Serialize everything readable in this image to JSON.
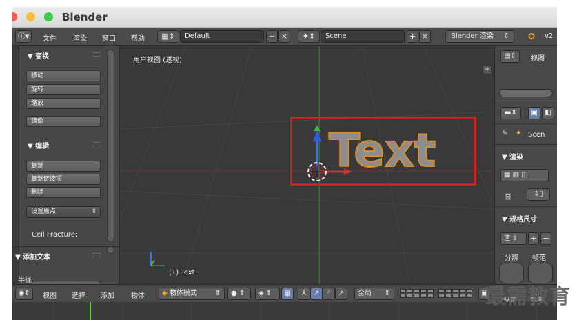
{
  "window": {
    "title": "Blender",
    "traffic_lights": [
      "#ee5a54",
      "#f6be3c",
      "#3cc94a"
    ]
  },
  "menubar": {
    "info_icon": "info-icon",
    "menus": [
      "文件",
      "渲染",
      "窗口",
      "帮助"
    ],
    "layout_name": "Default",
    "scene_name": "Scene",
    "render_engine": "Blender 渲染",
    "version_partial": "v2"
  },
  "toolshelf": {
    "transform_header": "▼ 变换",
    "transform_buttons": [
      "移动",
      "旋转",
      "缩放"
    ],
    "mirror_button": "镜像",
    "edit_header": "▼ 编辑",
    "edit_buttons": [
      "复制",
      "复制链接项",
      "删除"
    ],
    "set_origin": "设置原点",
    "cell_fracture": "Cell Fracture:",
    "add_text_header": "▼ 添加文本",
    "radius_label": "半径"
  },
  "viewport": {
    "title": "用户视图 (透视)",
    "object_label": "(1) Text",
    "text_object": "Text",
    "selection_color": "#d21e1e",
    "corner_plus": "+"
  },
  "props": {
    "view_label": "视图",
    "scene_label": "Scen",
    "render_header": "▼ 渲染",
    "display_label": "显",
    "dimensions_header": "▼ 规格尺寸",
    "preset_value": "渲",
    "plus": "+",
    "minus": "−",
    "resolution_label": "分辨",
    "frame_range_label": "帧范",
    "aspect_label": "纵横",
    "frame_rate_label": "帧率"
  },
  "bottombar": {
    "menus": [
      "视图",
      "选择",
      "添加",
      "物体"
    ],
    "mode": "物体模式",
    "pivot_value": "全局"
  },
  "watermark": {
    "text": "最需教育"
  }
}
